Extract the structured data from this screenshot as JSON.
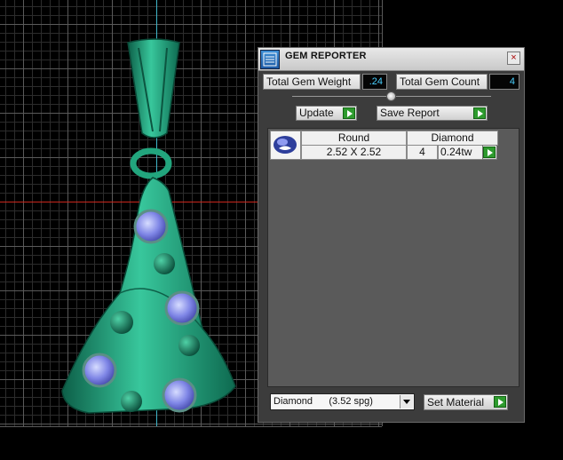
{
  "panel": {
    "title": "GEM REPORTER",
    "close_glyph": "×",
    "icon": "gem-reporter-app-icon"
  },
  "summary": {
    "total_weight_label": "Total Gem Weight",
    "total_weight_value": ".24",
    "total_count_label": "Total Gem Count",
    "total_count_value": "4"
  },
  "actions": {
    "update_label": "Update",
    "save_report_label": "Save Report"
  },
  "table": {
    "columns": [
      "Round",
      "Diamond"
    ],
    "rows": [
      {
        "icon": "round-gem-icon",
        "size": "2.52 X 2.52",
        "count": "4",
        "weight": "0.24tw"
      }
    ]
  },
  "material": {
    "selected": "Diamond      (3.52 spg)",
    "set_label": "Set Material"
  },
  "colors": {
    "gem_value_text": "#4ad0ff",
    "play_button": "#2e9b2e",
    "pendant_green": "#1f9e7a",
    "gem_blue": "#7f86e6",
    "axis_cyan": "#3fb6c9",
    "axis_red": "#c8261c"
  }
}
